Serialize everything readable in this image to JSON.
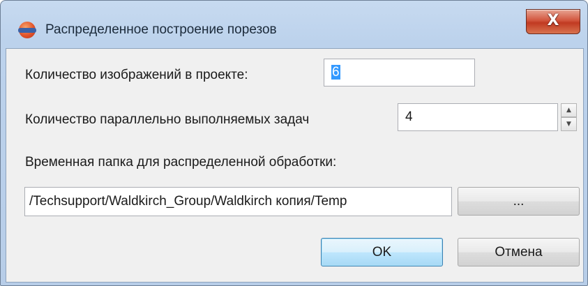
{
  "window": {
    "title": "Распределенное построение порезов",
    "close_glyph": "X",
    "icon": "app-sphere-icon"
  },
  "form": {
    "images_label": "Количество изображений в проекте:",
    "images_value": "6",
    "tasks_label": "Количество параллельно выполняемых задач",
    "tasks_value": "4",
    "folder_label": "Временная папка для распределенной обработки:",
    "folder_path": "/Techsupport/Waldkirch_Group/Waldkirch копия/Temp",
    "browse_label": "..."
  },
  "buttons": {
    "ok_label": "OK",
    "cancel_label": "Отмена"
  },
  "colors": {
    "selection": "#3399ff",
    "close_button": "#c13a22",
    "title_bar": "#bcd2ec"
  }
}
